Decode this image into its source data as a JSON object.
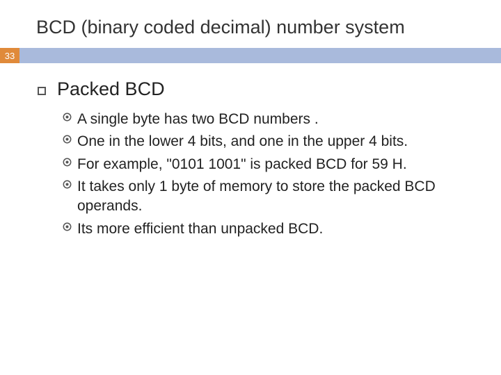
{
  "slide": {
    "title": "BCD (binary coded decimal) number system",
    "page_number": "33",
    "heading": "Packed BCD",
    "bullets": [
      "A single byte has two BCD numbers .",
      "One in the lower 4 bits, and one in the upper 4 bits.",
      "For example, \"0101 1001\" is packed BCD for 59 H.",
      "It takes only 1 byte of memory to store the packed BCD operands.",
      "Its more efficient than unpacked BCD."
    ]
  }
}
